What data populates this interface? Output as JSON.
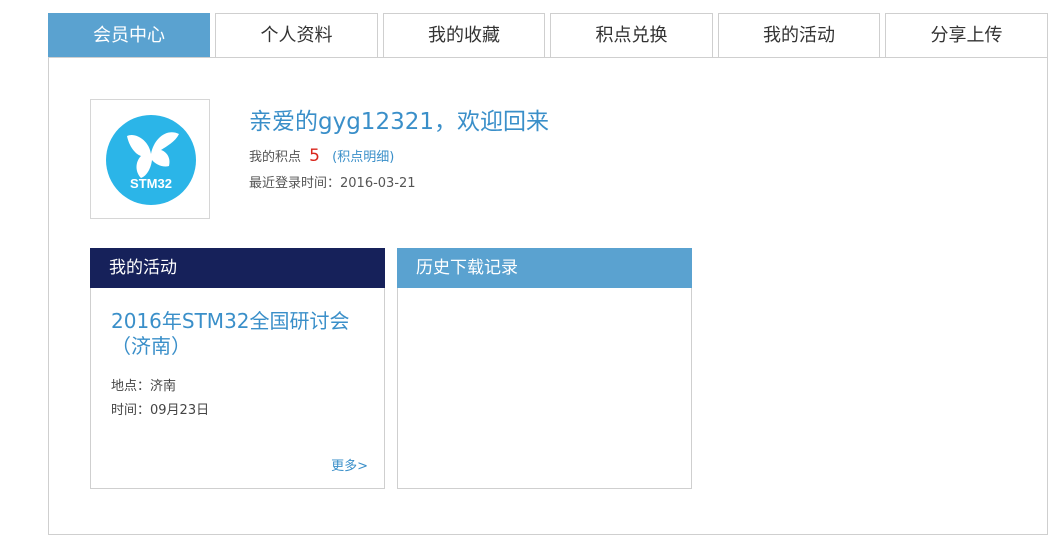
{
  "tabs": [
    {
      "label": "会员中心",
      "active": true
    },
    {
      "label": "个人资料",
      "active": false
    },
    {
      "label": "我的收藏",
      "active": false
    },
    {
      "label": "积点兑换",
      "active": false
    },
    {
      "label": "我的活动",
      "active": false
    },
    {
      "label": "分享上传",
      "active": false
    }
  ],
  "profile": {
    "avatar_icon": "stm32-butterfly-logo",
    "avatar_logo_text": "STM32",
    "welcome": "亲爱的gyg12321，欢迎回来",
    "points_label": "我的积点",
    "points_value": "5",
    "points_detail_open": "(",
    "points_detail_link": "积点明细",
    "points_detail_close": ")",
    "last_login": "最近登录时间：2016-03-21"
  },
  "activity_card": {
    "header": "我的活动",
    "event_title": "2016年STM32全国研讨会（济南）",
    "place": "地点：济南",
    "time": "时间：09月23日",
    "more": "更多>"
  },
  "history_card": {
    "header": "历史下载记录"
  },
  "colors": {
    "accent": "#5aa2d0",
    "dark_header": "#16215a",
    "link": "#3a8fc9",
    "points_red": "#d9261c",
    "logo_blue": "#2bb5e8"
  }
}
